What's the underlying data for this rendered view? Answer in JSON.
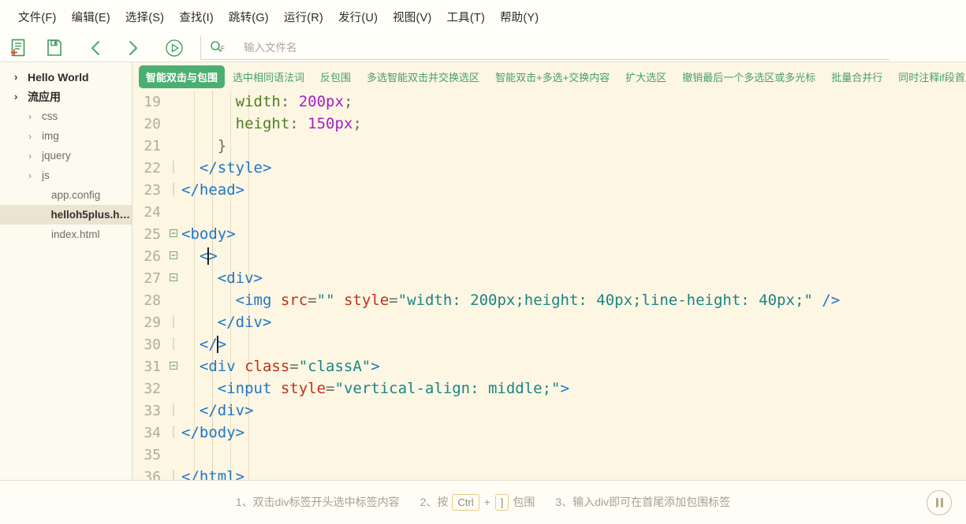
{
  "menu": {
    "items": [
      {
        "label": "文件(F)"
      },
      {
        "label": "编辑(E)"
      },
      {
        "label": "选择(S)"
      },
      {
        "label": "查找(I)"
      },
      {
        "label": "跳转(G)"
      },
      {
        "label": "运行(R)"
      },
      {
        "label": "发行(U)"
      },
      {
        "label": "视图(V)"
      },
      {
        "label": "工具(T)"
      },
      {
        "label": "帮助(Y)"
      }
    ]
  },
  "toolbar": {
    "icons": [
      {
        "name": "new-file-icon"
      },
      {
        "name": "save-icon"
      },
      {
        "name": "back-arrow-icon"
      },
      {
        "name": "forward-arrow-icon"
      },
      {
        "name": "run-icon"
      }
    ],
    "search": {
      "icon": "search-icon",
      "icon_label": "F",
      "placeholder": "输入文件名",
      "value": ""
    }
  },
  "sidebar": {
    "items": [
      {
        "label": "Hello World",
        "level": 0,
        "caret": "chevron-right-icon",
        "selected": false
      },
      {
        "label": "流应用",
        "level": 0,
        "caret": "chevron-right-icon",
        "selected": false
      },
      {
        "label": "css",
        "level": 1,
        "caret": "chevron-right-icon",
        "selected": false
      },
      {
        "label": "img",
        "level": 1,
        "caret": "chevron-right-icon",
        "selected": false
      },
      {
        "label": "jquery",
        "level": 1,
        "caret": "chevron-right-icon",
        "selected": false
      },
      {
        "label": "js",
        "level": 1,
        "caret": "chevron-right-icon",
        "selected": false
      },
      {
        "label": "app.config",
        "level": 2,
        "caret": "",
        "selected": false
      },
      {
        "label": "helloh5plus.html",
        "level": 2,
        "caret": "",
        "selected": true
      },
      {
        "label": "index.html",
        "level": 2,
        "caret": "",
        "selected": false
      }
    ]
  },
  "features": {
    "tabs": [
      {
        "label": "智能双击与包围",
        "active": true
      },
      {
        "label": "选中相同语法词",
        "active": false
      },
      {
        "label": "反包围",
        "active": false
      },
      {
        "label": "多选智能双击并交换选区",
        "active": false
      },
      {
        "label": "智能双击+多选+交换内容",
        "active": false
      },
      {
        "label": "扩大选区",
        "active": false
      },
      {
        "label": "撤销最后一个多选区或多光标",
        "active": false
      },
      {
        "label": "批量合并行",
        "active": false
      },
      {
        "label": "同时注释if段首尾",
        "active": false
      }
    ]
  },
  "editor": {
    "first_line": 19,
    "lines": [
      {
        "no": "19",
        "fold": "",
        "tokens": [
          {
            "t": "      ",
            "c": "t-plain"
          },
          {
            "t": "width",
            "c": "t-prop"
          },
          {
            "t": ": ",
            "c": "t-brace"
          },
          {
            "t": "200px",
            "c": "t-num"
          },
          {
            "t": ";",
            "c": "t-brace"
          }
        ]
      },
      {
        "no": "20",
        "fold": "",
        "tokens": [
          {
            "t": "      ",
            "c": "t-plain"
          },
          {
            "t": "height",
            "c": "t-prop"
          },
          {
            "t": ": ",
            "c": "t-brace"
          },
          {
            "t": "150px",
            "c": "t-num"
          },
          {
            "t": ";",
            "c": "t-brace"
          }
        ]
      },
      {
        "no": "21",
        "fold": "",
        "tokens": [
          {
            "t": "    }",
            "c": "t-brace"
          }
        ]
      },
      {
        "no": "22",
        "fold": "-",
        "tokens": [
          {
            "t": "  </style>",
            "c": "t-tag"
          }
        ]
      },
      {
        "no": "23",
        "fold": "-",
        "tokens": [
          {
            "t": "</head>",
            "c": "t-tag"
          }
        ]
      },
      {
        "no": "24",
        "fold": "",
        "tokens": [
          {
            "t": "",
            "c": "t-plain"
          }
        ]
      },
      {
        "no": "25",
        "fold": "+",
        "tokens": [
          {
            "t": "<body>",
            "c": "t-tag"
          }
        ]
      },
      {
        "no": "26",
        "fold": "+",
        "tokens": [
          {
            "t": "  <",
            "c": "t-tag"
          },
          {
            "t": "CURSOR",
            "c": "cursor"
          },
          {
            "t": ">",
            "c": "t-tag"
          }
        ]
      },
      {
        "no": "27",
        "fold": "+",
        "tokens": [
          {
            "t": "    <div>",
            "c": "t-tag"
          }
        ]
      },
      {
        "no": "28",
        "fold": "",
        "tokens": [
          {
            "t": "      <img ",
            "c": "t-tag"
          },
          {
            "t": "src",
            "c": "t-attr"
          },
          {
            "t": "=",
            "c": "t-brace"
          },
          {
            "t": "\"\"",
            "c": "t-val"
          },
          {
            "t": " ",
            "c": "t-plain"
          },
          {
            "t": "style",
            "c": "t-attr"
          },
          {
            "t": "=",
            "c": "t-brace"
          },
          {
            "t": "\"width: 200px;height: 40px;line-height: 40px;\"",
            "c": "t-val"
          },
          {
            "t": " />",
            "c": "t-tag"
          }
        ]
      },
      {
        "no": "29",
        "fold": "-",
        "tokens": [
          {
            "t": "    </div>",
            "c": "t-tag"
          }
        ]
      },
      {
        "no": "30",
        "fold": "-",
        "tokens": [
          {
            "t": "  </",
            "c": "t-tag"
          },
          {
            "t": "CURSOR",
            "c": "cursor"
          },
          {
            "t": ">",
            "c": "t-tag"
          }
        ]
      },
      {
        "no": "31",
        "fold": "+",
        "tokens": [
          {
            "t": "  <div ",
            "c": "t-tag"
          },
          {
            "t": "class",
            "c": "t-attr"
          },
          {
            "t": "=",
            "c": "t-brace"
          },
          {
            "t": "\"classA\"",
            "c": "t-val"
          },
          {
            "t": ">",
            "c": "t-tag"
          }
        ]
      },
      {
        "no": "32",
        "fold": "",
        "tokens": [
          {
            "t": "    <input ",
            "c": "t-tag"
          },
          {
            "t": "style",
            "c": "t-attr"
          },
          {
            "t": "=",
            "c": "t-brace"
          },
          {
            "t": "\"vertical-align: middle;\"",
            "c": "t-val"
          },
          {
            "t": ">",
            "c": "t-tag"
          }
        ]
      },
      {
        "no": "33",
        "fold": "-",
        "tokens": [
          {
            "t": "  </div>",
            "c": "t-tag"
          }
        ]
      },
      {
        "no": "34",
        "fold": "-",
        "tokens": [
          {
            "t": "</body>",
            "c": "t-tag"
          }
        ]
      },
      {
        "no": "35",
        "fold": "",
        "tokens": [
          {
            "t": "",
            "c": "t-plain"
          }
        ]
      },
      {
        "no": "36",
        "fold": "-",
        "tokens": [
          {
            "t": "</html>",
            "c": "t-tag"
          }
        ]
      }
    ]
  },
  "status": {
    "hints": [
      {
        "prefix": "1、双击div标签开头选中标签内容",
        "keys": [],
        "suffix": ""
      },
      {
        "prefix": "2、按",
        "keys": [
          "Ctrl",
          "]"
        ],
        "suffix": "包围"
      },
      {
        "prefix": "3、输入div即可在首尾添加包围标签",
        "keys": [],
        "suffix": ""
      }
    ],
    "pause_button": "pause-icon"
  },
  "colors": {
    "accent_green": "#4caf72",
    "editor_bg": "#fdf6e3",
    "sidebar_bg": "#fdfbf0",
    "selected_row": "#ece4d0"
  }
}
